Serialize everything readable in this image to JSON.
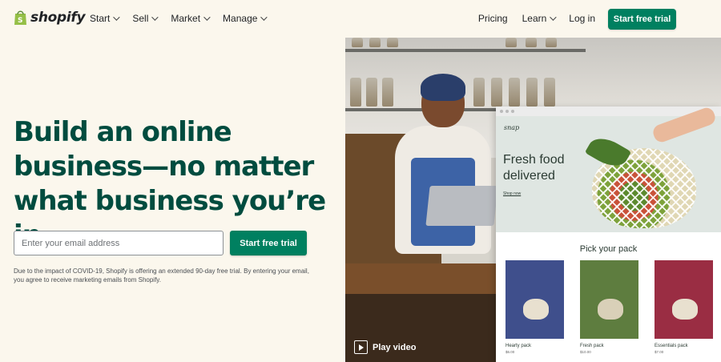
{
  "brand": {
    "name": "shopify",
    "colors": {
      "accent": "#008060",
      "headline": "#004c3f",
      "background": "#fbf7ed"
    }
  },
  "nav": {
    "left": [
      {
        "label": "Start",
        "icon": "chevron-down-icon"
      },
      {
        "label": "Sell",
        "icon": "chevron-down-icon"
      },
      {
        "label": "Market",
        "icon": "chevron-down-icon"
      },
      {
        "label": "Manage",
        "icon": "chevron-down-icon"
      }
    ],
    "right": [
      {
        "label": "Pricing"
      },
      {
        "label": "Learn",
        "icon": "chevron-down-icon"
      },
      {
        "label": "Log in"
      }
    ],
    "cta": "Start free trial"
  },
  "hero": {
    "title": "Build an online business—no matter what business you’re in",
    "email_placeholder": "Enter your email address",
    "email_value": "",
    "cta": "Start free trial",
    "disclaimer": "Due to the impact of COVID-19, Shopify is offering an extended 90-day free trial. By entering your email, you agree to receive marketing emails from Shopify.",
    "play_label": "Play video"
  },
  "store": {
    "brand": "snap",
    "headline": "Fresh food delivered",
    "shop_link": "Shop now",
    "pack_title": "Pick your pack",
    "packs": [
      {
        "name": "Hearty pack",
        "price": "$6.00",
        "color": "#3f4f8c"
      },
      {
        "name": "Fresh pack",
        "price": "$10.00",
        "color": "#5e7d3f"
      },
      {
        "name": "Essentials pack",
        "price": "$7.00",
        "color": "#9a2d43"
      }
    ]
  }
}
